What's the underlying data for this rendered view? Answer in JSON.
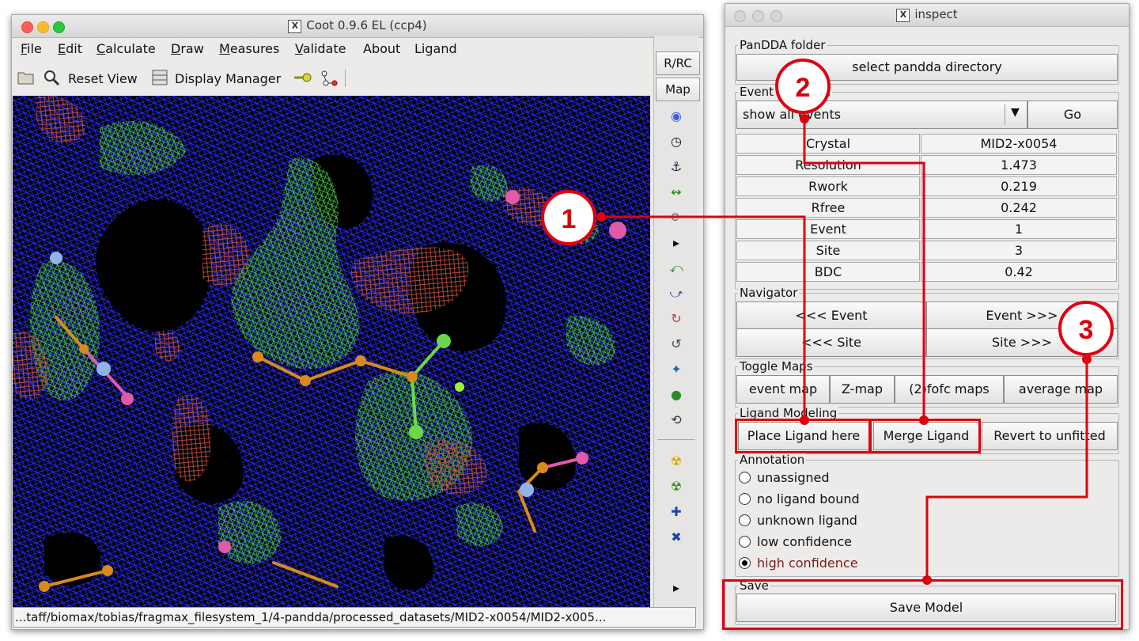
{
  "coot": {
    "title": "Coot 0.9.6 EL (ccp4)",
    "menu": [
      {
        "label": "File",
        "u": "F",
        "rest": "ile"
      },
      {
        "label": "Edit",
        "u": "E",
        "rest": "dit"
      },
      {
        "label": "Calculate",
        "u": "C",
        "rest": "alculate"
      },
      {
        "label": "Draw",
        "u": "D",
        "rest": "raw"
      },
      {
        "label": "Measures",
        "u": "M",
        "rest": "easures"
      },
      {
        "label": "Validate",
        "u": "V",
        "rest": "alidate"
      },
      {
        "label": "About",
        "u": "",
        "rest": "About"
      },
      {
        "label": "Ligand",
        "u": "",
        "rest": "Ligand"
      }
    ],
    "toolbar": {
      "reset_view": "Reset View",
      "display_manager": "Display Manager"
    },
    "sidebar": {
      "rrc": "R/RC",
      "map": "Map"
    },
    "status_path": "...taff/biomax/tobias/fragmax_filesystem_1/4-pandda/processed_datasets/MID2-x0054/MID2-x005..."
  },
  "inspect": {
    "title": "inspect",
    "pandda_folder": {
      "label": "PanDDA folder",
      "button": "select pandda directory"
    },
    "event_selection": {
      "label": "Event selection",
      "dropdown_value": "show all events",
      "go": "Go"
    },
    "info_rows": [
      {
        "key": "Crystal",
        "value": "MID2-x0054"
      },
      {
        "key": "Resolution",
        "value": "1.473"
      },
      {
        "key": "Rwork",
        "value": "0.219"
      },
      {
        "key": "Rfree",
        "value": "0.242"
      },
      {
        "key": "Event",
        "value": "1"
      },
      {
        "key": "Site",
        "value": "3"
      },
      {
        "key": "BDC",
        "value": "0.42"
      }
    ],
    "navigator": {
      "label": "Navigator",
      "prev_event": "<<< Event",
      "next_event": "Event >>>",
      "prev_site": "<<< Site",
      "next_site": "Site >>>"
    },
    "toggle_maps": {
      "label": "Toggle Maps",
      "buttons": [
        "event map",
        "Z-map",
        "(2)fofc maps",
        "average map"
      ]
    },
    "ligand_modeling": {
      "label": "Ligand Modeling",
      "place": "Place Ligand here",
      "merge": "Merge Ligand",
      "revert": "Revert to unfitted"
    },
    "annotation": {
      "label": "Annotation",
      "options": [
        "unassigned",
        "no ligand bound",
        "unknown ligand",
        "low confidence",
        "high confidence"
      ],
      "selected": "high confidence"
    },
    "save": {
      "label": "Save",
      "button": "Save Model"
    }
  },
  "callouts": [
    "1",
    "2",
    "3"
  ],
  "colors": {
    "highlight": "#e0000f",
    "map_blue": "#2a2aff",
    "map_green": "#3fb83f",
    "map_red": "#c0503f",
    "selected_text": "#7a1a1a"
  }
}
